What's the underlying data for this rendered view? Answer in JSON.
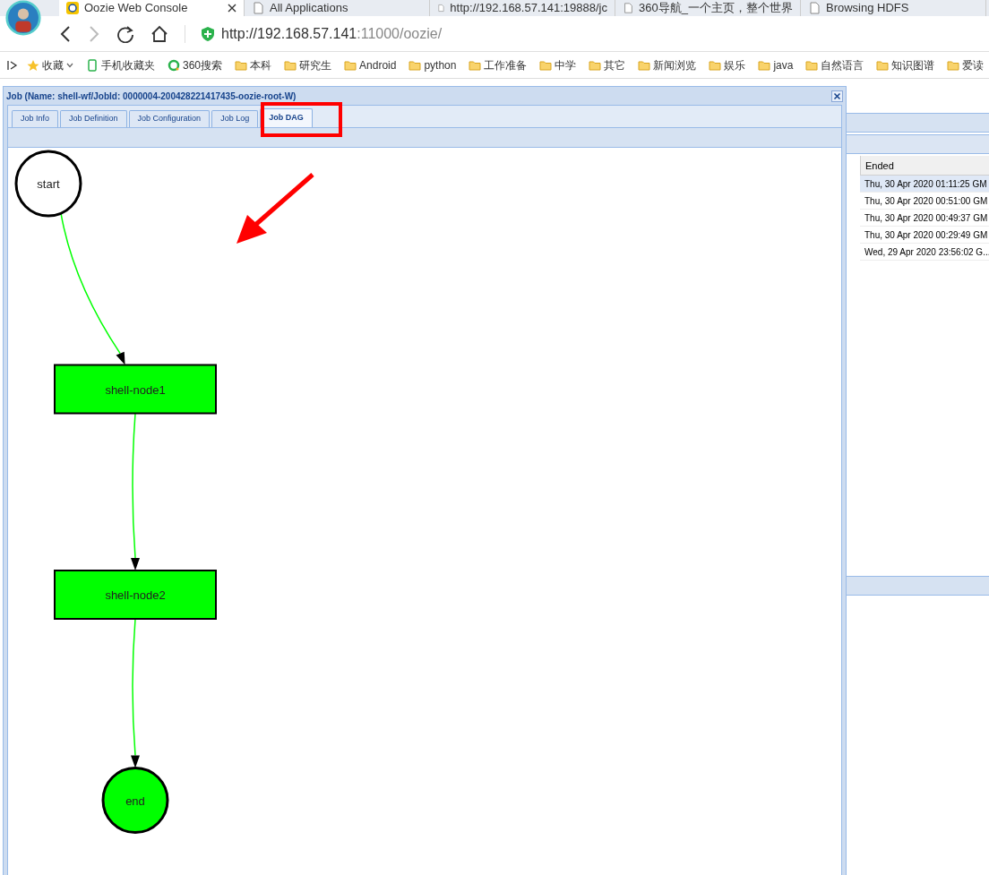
{
  "browser_tabs": [
    {
      "label": "Oozie Web Console",
      "selected": true
    },
    {
      "label": "All Applications",
      "selected": false
    },
    {
      "label": "http://192.168.57.141:19888/jc",
      "selected": false
    },
    {
      "label": "360导航_一个主页，整个世界",
      "selected": false
    },
    {
      "label": "Browsing HDFS",
      "selected": false
    }
  ],
  "address_bar": {
    "host": "http://192.168.57.141",
    "rest": ":11000/oozie/"
  },
  "bookmarks": [
    {
      "label": "收藏",
      "kind": "star"
    },
    {
      "label": "手机收藏夹",
      "kind": "phone"
    },
    {
      "label": "360搜索",
      "kind": "search"
    },
    {
      "label": "本科",
      "kind": "folder"
    },
    {
      "label": "研究生",
      "kind": "folder"
    },
    {
      "label": "Android",
      "kind": "folder"
    },
    {
      "label": "python",
      "kind": "folder"
    },
    {
      "label": "工作准备",
      "kind": "folder"
    },
    {
      "label": "中学",
      "kind": "folder"
    },
    {
      "label": "其它",
      "kind": "folder"
    },
    {
      "label": "新闻浏览",
      "kind": "folder"
    },
    {
      "label": "娱乐",
      "kind": "folder"
    },
    {
      "label": "java",
      "kind": "folder"
    },
    {
      "label": "自然语言",
      "kind": "folder"
    },
    {
      "label": "知识图谱",
      "kind": "folder"
    },
    {
      "label": "爱读",
      "kind": "folder"
    }
  ],
  "background_table": {
    "column": "Ended",
    "rows": [
      "Thu, 30 Apr 2020 01:11:25 GM",
      "Thu, 30 Apr 2020 00:51:00 GM",
      "Thu, 30 Apr 2020 00:49:37 GM",
      "Thu, 30 Apr 2020 00:29:49 GM",
      "Wed, 29 Apr 2020 23:56:02 G..."
    ]
  },
  "dialog": {
    "title": "Job (Name: shell-wf/JobId: 0000004-200428221417435-oozie-root-W)",
    "tabs": [
      {
        "label": "Job Info",
        "selected": false
      },
      {
        "label": "Job Definition",
        "selected": false
      },
      {
        "label": "Job Configuration",
        "selected": false
      },
      {
        "label": "Job Log",
        "selected": false
      },
      {
        "label": "Job DAG",
        "selected": true
      }
    ],
    "dag": {
      "nodes": [
        {
          "label": "start",
          "kind": "circle",
          "color": "#ffffff"
        },
        {
          "label": "shell-node1",
          "kind": "action",
          "color": "#00ff00"
        },
        {
          "label": "shell-node2",
          "kind": "action",
          "color": "#00ff00"
        },
        {
          "label": "end",
          "kind": "circle",
          "color": "#00ff00"
        }
      ]
    }
  }
}
